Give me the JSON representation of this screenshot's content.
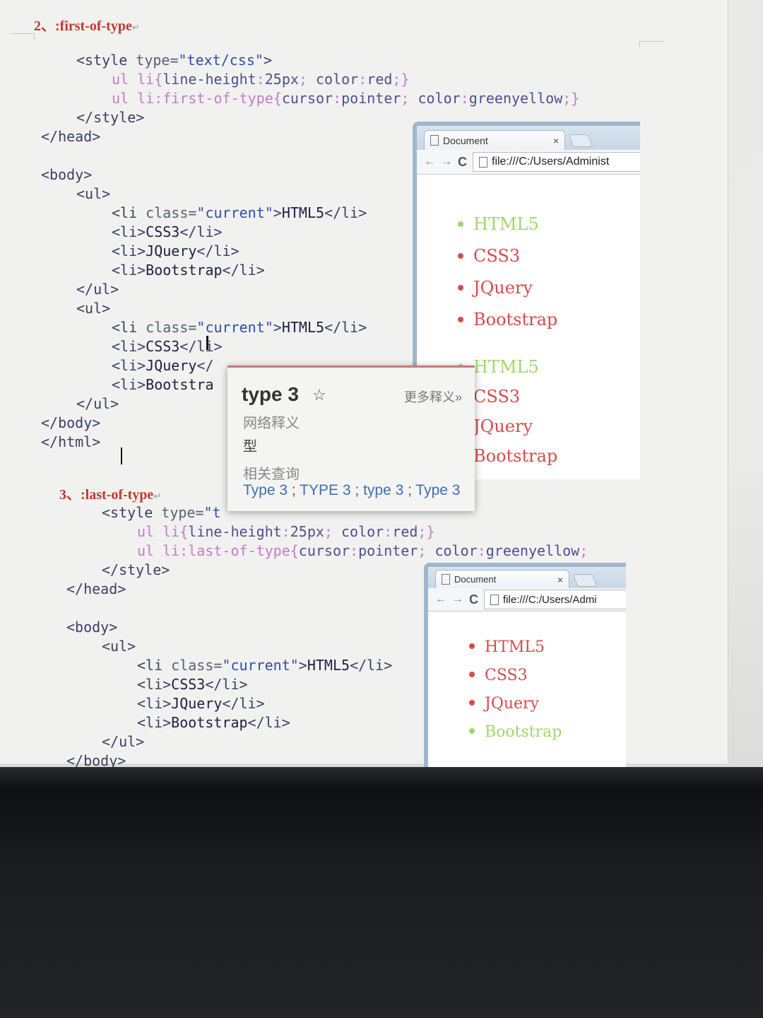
{
  "section1": {
    "heading": "2、:first-of-type",
    "code": [
      {
        "indent": 0,
        "parts": [
          [
            "tag",
            "<style "
          ],
          [
            "attr",
            "type="
          ],
          [
            "str",
            "\"text/css\""
          ],
          [
            "tag",
            ">"
          ]
        ]
      },
      {
        "indent": 1,
        "parts": [
          [
            "sel",
            "ul li{"
          ],
          [
            "prop",
            "line-height"
          ],
          [
            "sel",
            ":"
          ],
          [
            "prop",
            "25px"
          ],
          [
            "sel",
            "; "
          ],
          [
            "prop",
            "color"
          ],
          [
            "sel",
            ":"
          ],
          [
            "prop",
            "red"
          ],
          [
            "sel",
            ";}"
          ]
        ]
      },
      {
        "indent": 1,
        "parts": [
          [
            "sel",
            "ul li:first-of-type{"
          ],
          [
            "prop",
            "cursor"
          ],
          [
            "sel",
            ":"
          ],
          [
            "prop",
            "pointer"
          ],
          [
            "sel",
            "; "
          ],
          [
            "prop",
            "color"
          ],
          [
            "sel",
            ":"
          ],
          [
            "prop",
            "greenyellow"
          ],
          [
            "sel",
            ";}"
          ]
        ]
      },
      {
        "indent": 0,
        "parts": [
          [
            "tag",
            "</style>"
          ]
        ]
      },
      {
        "indent": -1,
        "parts": [
          [
            "tag",
            "</head>"
          ]
        ]
      },
      {
        "indent": -1,
        "parts": [
          [
            "txt",
            ""
          ]
        ]
      },
      {
        "indent": -1,
        "parts": [
          [
            "tag",
            "<body>"
          ]
        ]
      },
      {
        "indent": 0,
        "parts": [
          [
            "tag",
            "<ul>"
          ]
        ]
      },
      {
        "indent": 1,
        "parts": [
          [
            "tag",
            "<li "
          ],
          [
            "attr",
            "class="
          ],
          [
            "str",
            "\"current\""
          ],
          [
            "tag",
            ">"
          ],
          [
            "txt",
            "HTML5"
          ],
          [
            "tag",
            "</li>"
          ]
        ]
      },
      {
        "indent": 1,
        "parts": [
          [
            "tag",
            "<li>"
          ],
          [
            "txt",
            "CSS3"
          ],
          [
            "tag",
            "</li>"
          ]
        ]
      },
      {
        "indent": 1,
        "parts": [
          [
            "tag",
            "<li>"
          ],
          [
            "txt",
            "JQuery"
          ],
          [
            "tag",
            "</li>"
          ]
        ]
      },
      {
        "indent": 1,
        "parts": [
          [
            "tag",
            "<li>"
          ],
          [
            "txt",
            "Bootstrap"
          ],
          [
            "tag",
            "</li>"
          ]
        ]
      },
      {
        "indent": 0,
        "parts": [
          [
            "tag",
            "</ul>"
          ]
        ]
      },
      {
        "indent": 0,
        "parts": [
          [
            "tag",
            "<ul>"
          ]
        ]
      },
      {
        "indent": 1,
        "parts": [
          [
            "tag",
            "<li "
          ],
          [
            "attr",
            "class="
          ],
          [
            "str",
            "\"current\""
          ],
          [
            "tag",
            ">"
          ],
          [
            "txt",
            "HTML5"
          ],
          [
            "tag",
            "</li>"
          ]
        ]
      },
      {
        "indent": 1,
        "parts": [
          [
            "tag",
            "<li>"
          ],
          [
            "txt",
            "CSS3"
          ],
          [
            "tag",
            "</li>"
          ]
        ]
      },
      {
        "indent": 1,
        "parts": [
          [
            "tag",
            "<li>"
          ],
          [
            "txt",
            "JQuery"
          ],
          [
            "tag",
            "</"
          ]
        ]
      },
      {
        "indent": 1,
        "parts": [
          [
            "tag",
            "<li>"
          ],
          [
            "txt",
            "Bootstra"
          ]
        ]
      },
      {
        "indent": 0,
        "parts": [
          [
            "tag",
            "</ul>"
          ]
        ]
      },
      {
        "indent": -1,
        "parts": [
          [
            "tag",
            "</body>"
          ]
        ]
      },
      {
        "indent": -1,
        "parts": [
          [
            "tag",
            "</html>"
          ]
        ]
      }
    ]
  },
  "section2": {
    "heading": "3、:last-of-type",
    "code": [
      {
        "indent": 0,
        "parts": [
          [
            "tag",
            "<style "
          ],
          [
            "attr",
            "type="
          ],
          [
            "str",
            "\"t"
          ]
        ]
      },
      {
        "indent": 1,
        "parts": [
          [
            "sel",
            "ul li{"
          ],
          [
            "prop",
            "line-height"
          ],
          [
            "sel",
            ":"
          ],
          [
            "prop",
            "25px"
          ],
          [
            "sel",
            "; "
          ],
          [
            "prop",
            "color"
          ],
          [
            "sel",
            ":"
          ],
          [
            "prop",
            "red"
          ],
          [
            "sel",
            ";}"
          ]
        ]
      },
      {
        "indent": 1,
        "parts": [
          [
            "sel",
            "ul li:last-of-type{"
          ],
          [
            "prop",
            "cursor"
          ],
          [
            "sel",
            ":"
          ],
          [
            "prop",
            "pointer"
          ],
          [
            "sel",
            "; "
          ],
          [
            "prop",
            "color"
          ],
          [
            "sel",
            ":"
          ],
          [
            "prop",
            "greenyellow"
          ],
          [
            "sel",
            ";"
          ]
        ]
      },
      {
        "indent": 0,
        "parts": [
          [
            "tag",
            "</style>"
          ]
        ]
      },
      {
        "indent": -1,
        "parts": [
          [
            "tag",
            "</head>"
          ]
        ]
      },
      {
        "indent": -1,
        "parts": [
          [
            "txt",
            ""
          ]
        ]
      },
      {
        "indent": -1,
        "parts": [
          [
            "tag",
            "<body>"
          ]
        ]
      },
      {
        "indent": 0,
        "parts": [
          [
            "tag",
            "<ul>"
          ]
        ]
      },
      {
        "indent": 1,
        "parts": [
          [
            "tag",
            "<li "
          ],
          [
            "attr",
            "class="
          ],
          [
            "str",
            "\"current\""
          ],
          [
            "tag",
            ">"
          ],
          [
            "txt",
            "HTML5"
          ],
          [
            "tag",
            "</li>"
          ]
        ]
      },
      {
        "indent": 1,
        "parts": [
          [
            "tag",
            "<li>"
          ],
          [
            "txt",
            "CSS3"
          ],
          [
            "tag",
            "</li>"
          ]
        ]
      },
      {
        "indent": 1,
        "parts": [
          [
            "tag",
            "<li>"
          ],
          [
            "txt",
            "JQuery"
          ],
          [
            "tag",
            "</li>"
          ]
        ]
      },
      {
        "indent": 1,
        "parts": [
          [
            "tag",
            "<li>"
          ],
          [
            "txt",
            "Bootstrap"
          ],
          [
            "tag",
            "</li>"
          ]
        ]
      },
      {
        "indent": 0,
        "parts": [
          [
            "tag",
            "</ul>"
          ]
        ]
      },
      {
        "indent": -1,
        "parts": [
          [
            "tag",
            "</body>"
          ]
        ]
      }
    ]
  },
  "browser1": {
    "tab_title": "Document",
    "tab_close": "×",
    "url": "file:///C:/Users/Administ",
    "list1": [
      {
        "text": "HTML5",
        "color": "greenyellow"
      },
      {
        "text": "CSS3",
        "color": "red"
      },
      {
        "text": "JQuery",
        "color": "red"
      },
      {
        "text": "Bootstrap",
        "color": "red"
      }
    ],
    "list2": [
      {
        "text": "HTML5",
        "color": "greenyellow"
      },
      {
        "text": "CSS3",
        "color": "red"
      },
      {
        "text": "JQuery",
        "color": "red"
      },
      {
        "text": "Bootstrap",
        "color": "red"
      }
    ]
  },
  "browser2": {
    "tab_title": "Document",
    "tab_close": "×",
    "url": "file:///C:/Users/Admi",
    "list": [
      {
        "text": "HTML5",
        "color": "red"
      },
      {
        "text": "CSS3",
        "color": "red"
      },
      {
        "text": "JQuery",
        "color": "red"
      },
      {
        "text": "Bootstrap",
        "color": "greenyellow"
      }
    ]
  },
  "dictionary_popup": {
    "word": "type 3",
    "star_icon": "star-outline-icon",
    "more_link": "更多释义»",
    "web_label": "网络释义",
    "meaning": "型",
    "related_label": "相关查询",
    "related": [
      "Type 3",
      "TYPE 3",
      "type 3",
      "Type 3"
    ]
  },
  "colors": {
    "heading": "#c0392b",
    "red_item": "#d84b4b",
    "greenyellow_item": "#9fd86a",
    "link": "#3f6fb0"
  }
}
